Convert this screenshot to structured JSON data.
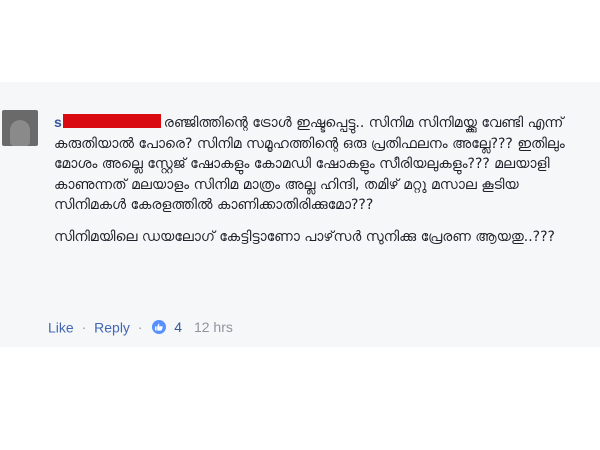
{
  "comment": {
    "author_initial": "s",
    "line1": "രഞ്ജിത്തിന്റെ ട്രോൾ ഇഷ്ടപ്പെട്ടു.. സിനിമ സിനിമയ്ക്കു വേണ്ടി എന്ന് കരുതിയാൽ പോരെ? സിനിമ സമൂഹത്തിന്റെ ഒരു പ്രതിഫലനം അല്ലേ??? ഇതിലും മോശം അല്ലെ സ്റ്റേജ് ഷോകളും കോമഡി ഷോകളും സീരിയലുകളും??? മലയാളി കാണുന്നത് മലയാളം സിനിമ മാത്രം അല്ല ഹിന്ദി, തമിഴ് മറ്റു മസാല കൂടിയ സിനിമകൾ കേരളത്തിൽ കാണിക്കാതിരിക്കുമോ???",
    "line2": "സിനിമയിലെ ഡയലോഗ് കേട്ടിട്ടാണോ പാഴ്‌സർ സുനിക്കു പ്രേരണ ആയതു..???"
  },
  "actions": {
    "like_label": "Like",
    "reply_label": "Reply",
    "separator": "·",
    "like_count": "4",
    "timestamp": "12 hrs"
  },
  "icons": {
    "avatar": "avatar-image",
    "reaction": "thumbs-up-icon"
  },
  "colors": {
    "link": "#4267b2",
    "redaction": "#d90a12",
    "card_bg": "#f6f7f9"
  }
}
